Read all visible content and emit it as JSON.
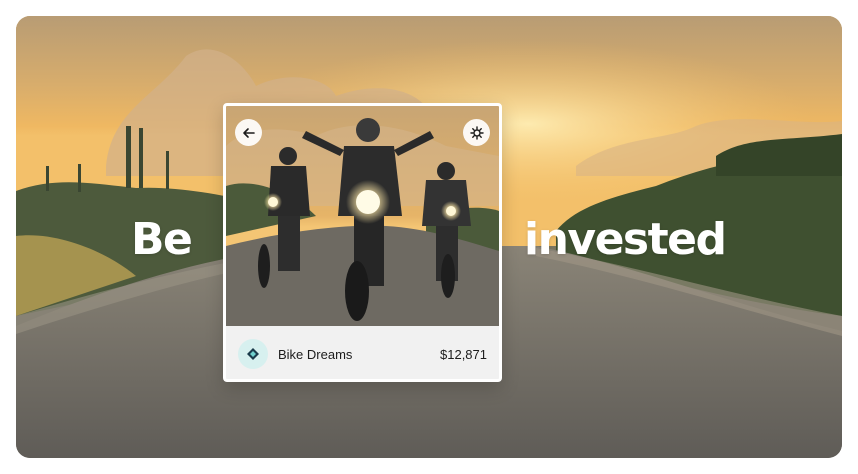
{
  "hero": {
    "headline_left": "Be",
    "headline_right": "invested"
  },
  "card": {
    "back_icon": "arrow-left-icon",
    "settings_icon": "gear-icon",
    "product_icon": "bike-dreams-logo-icon",
    "product_name": "Bike Dreams",
    "price": "$12,871"
  },
  "colors": {
    "sky": "#e8b564",
    "road": "#6a6760",
    "footer_bg": "#f1f1f1",
    "logo_bg": "#d7f0ef",
    "text": "#1c1c1c"
  }
}
